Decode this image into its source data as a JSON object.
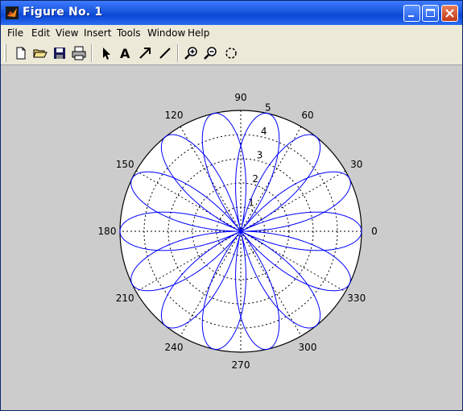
{
  "window": {
    "title": "Figure No. 1"
  },
  "menu": [
    "File",
    "Edit",
    "View",
    "Insert",
    "Tools",
    "Window",
    "Help"
  ],
  "toolbar_icons": [
    "new-file-icon",
    "open-folder-icon",
    "save-icon",
    "print-icon",
    "select-arrow-icon",
    "insert-text-icon",
    "insert-arrow-icon",
    "insert-line-icon",
    "zoom-in-icon",
    "zoom-out-icon",
    "rotate-icon"
  ],
  "colors": {
    "curve": "#0000ff",
    "figure_bg": "#cccccc",
    "axes_bg": "#ffffff"
  },
  "chart_data": {
    "type": "polar",
    "function": "r = 5*cos(3.5*theta)",
    "title": "",
    "r_ticks": [
      "1",
      "2",
      "3",
      "4",
      "5"
    ],
    "rlim": [
      0,
      5
    ],
    "angle_ticks": [
      "0",
      "30",
      "60",
      "90",
      "120",
      "150",
      "180",
      "210",
      "240",
      "270",
      "300",
      "330"
    ],
    "grid": true,
    "series": [
      {
        "k": 3.5,
        "amplitude": 5,
        "theta_range_deg": [
          0,
          720
        ]
      }
    ]
  }
}
